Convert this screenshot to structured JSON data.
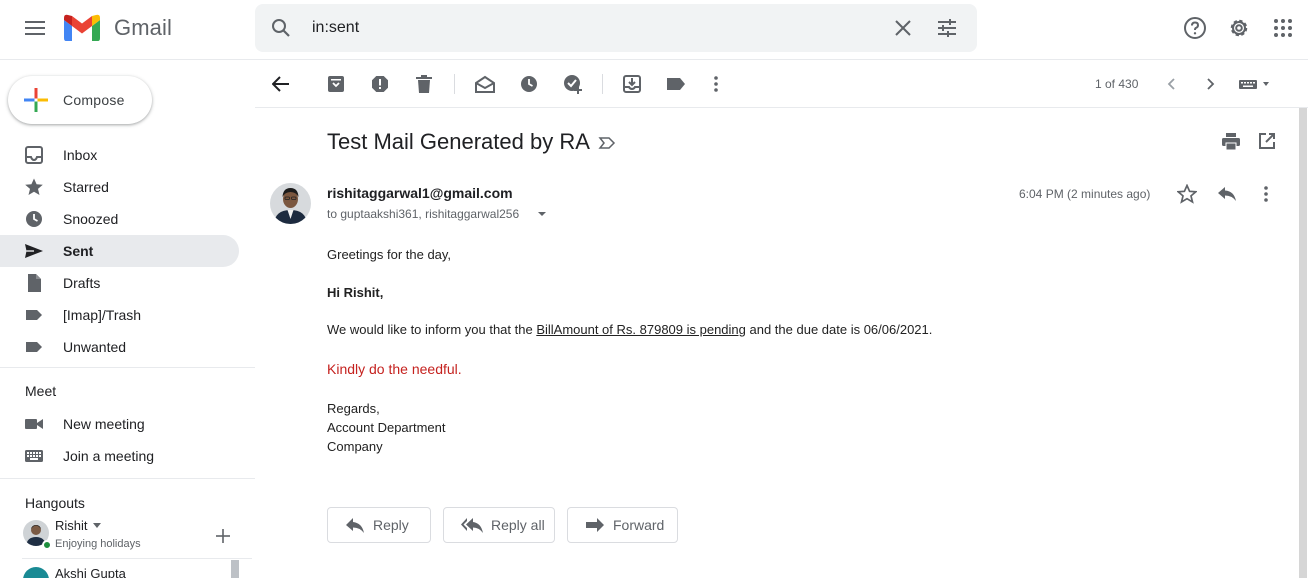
{
  "app": {
    "name": "Gmail"
  },
  "search": {
    "query": "in:sent"
  },
  "compose": {
    "label": "Compose"
  },
  "sidebar": {
    "items": [
      {
        "label": "Inbox",
        "icon": "inbox-icon"
      },
      {
        "label": "Starred",
        "icon": "star-icon"
      },
      {
        "label": "Snoozed",
        "icon": "clock-icon"
      },
      {
        "label": "Sent",
        "icon": "send-icon",
        "active": true
      },
      {
        "label": "Drafts",
        "icon": "draft-icon"
      },
      {
        "label": "[Imap]/Trash",
        "icon": "label-icon"
      },
      {
        "label": "Unwanted",
        "icon": "label-icon"
      }
    ]
  },
  "meet": {
    "title": "Meet",
    "items": [
      {
        "label": "New meeting",
        "icon": "video-icon"
      },
      {
        "label": "Join a meeting",
        "icon": "keyboard-icon"
      }
    ]
  },
  "hangouts": {
    "title": "Hangouts",
    "user": {
      "name": "Rishit",
      "status": "Enjoying holidays"
    },
    "contacts": [
      {
        "name": "Akshi Gupta"
      }
    ]
  },
  "toolbar": {
    "pager": "1 of 430"
  },
  "email": {
    "subject": "Test Mail Generated by RA",
    "sender": "rishitaggarwal1@gmail.com",
    "to": "to guptaakshi361, rishitaggarwal256",
    "time": "6:04 PM (2 minutes ago)",
    "greeting": "Greetings for the day,",
    "salutation": "Hi Rishit,",
    "line_prefix": "We would like to inform you that the ",
    "line_link": "BillAmount of Rs. 879809 is pending",
    "line_suffix": " and the due date is 06/06/2021.",
    "request": "Kindly do the needful.",
    "signoff": "Regards,",
    "department": "Account Department",
    "company": "Company"
  },
  "actions": {
    "reply": "Reply",
    "reply_all": "Reply all",
    "forward": "Forward"
  },
  "colors": {
    "accent_red": "#c5221f",
    "active_bg": "#e8eaed",
    "icon_gray": "#5f6368"
  }
}
